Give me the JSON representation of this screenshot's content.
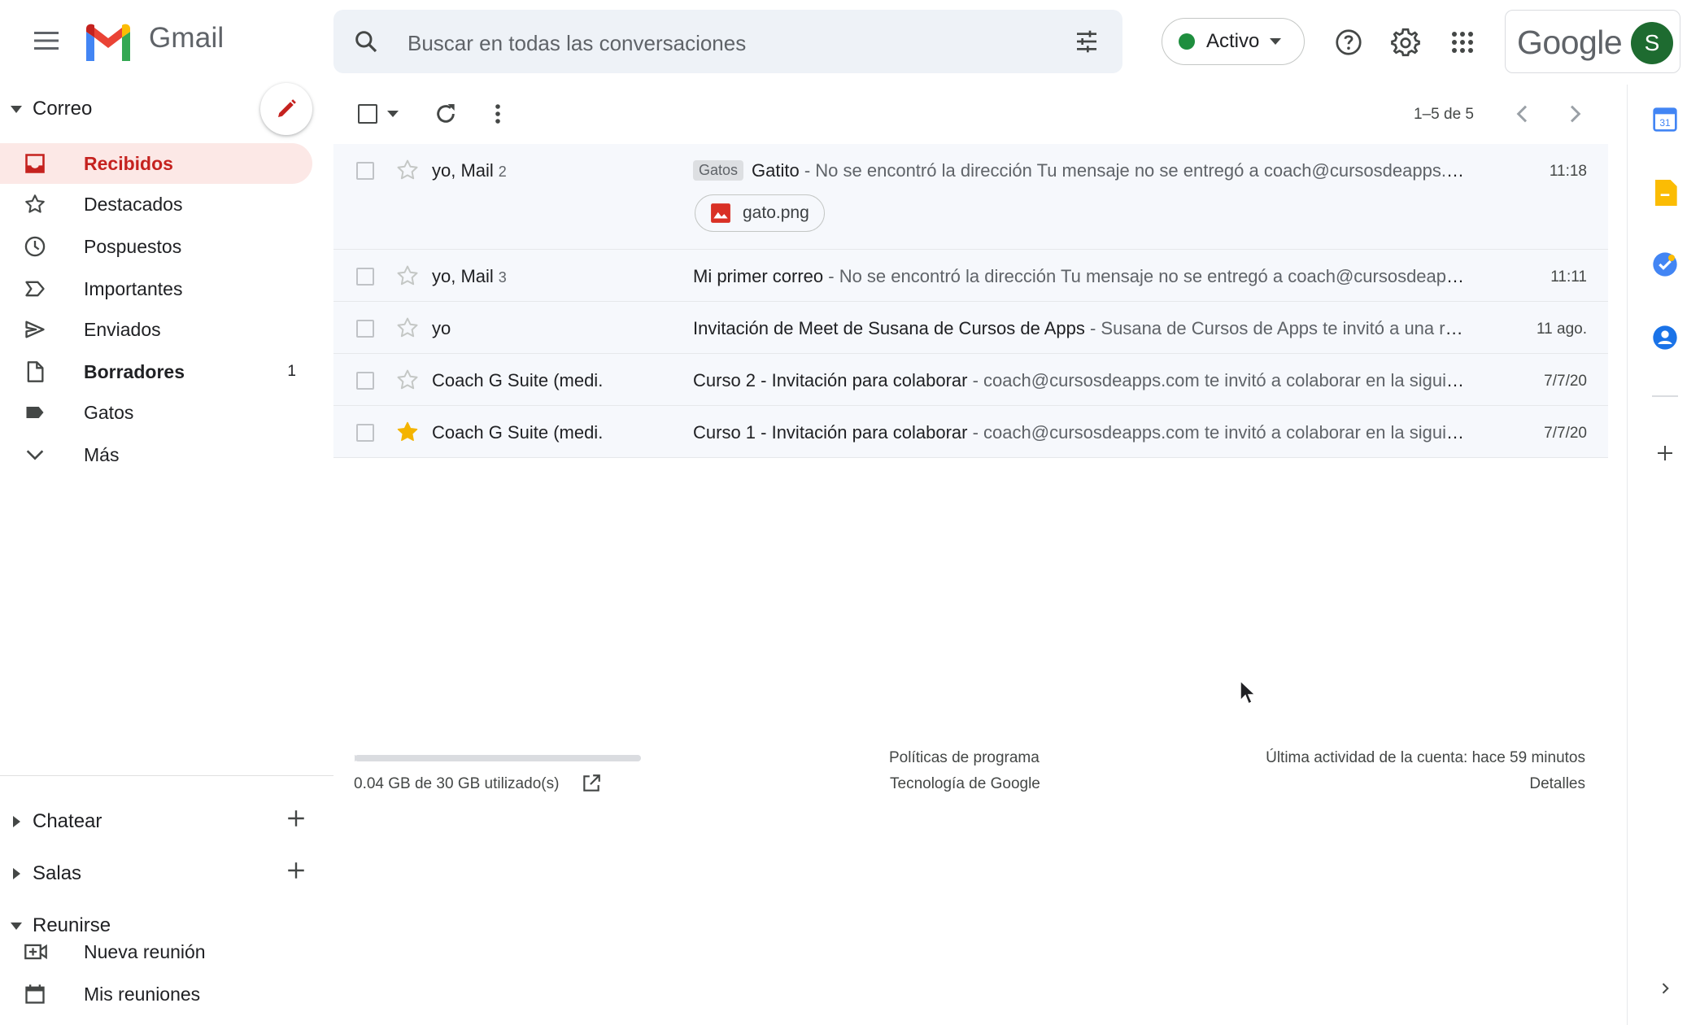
{
  "app": {
    "name": "Gmail"
  },
  "search": {
    "placeholder": "Buscar en todas las conversaciones"
  },
  "status": {
    "label": "Activo",
    "color": "#1e8e3e"
  },
  "account": {
    "brand": "Google",
    "avatar_letter": "S"
  },
  "sidebar": {
    "mail_section": "Correo",
    "items": [
      {
        "label": "Recibidos",
        "icon": "inbox-icon",
        "active": true,
        "count": ""
      },
      {
        "label": "Destacados",
        "icon": "star-icon",
        "count": ""
      },
      {
        "label": "Pospuestos",
        "icon": "clock-icon",
        "count": ""
      },
      {
        "label": "Importantes",
        "icon": "label-important-icon",
        "count": ""
      },
      {
        "label": "Enviados",
        "icon": "send-icon",
        "count": ""
      },
      {
        "label": "Borradores",
        "icon": "draft-icon",
        "count": "1",
        "bold": true
      },
      {
        "label": "Gatos",
        "icon": "label-icon",
        "count": ""
      },
      {
        "label": "Más",
        "icon": "chevron-down-icon",
        "count": ""
      }
    ],
    "chat_section": "Chatear",
    "rooms_section": "Salas",
    "meet_section": "Reunirse",
    "meet_items": [
      {
        "label": "Nueva reunión",
        "icon": "video-add-icon"
      },
      {
        "label": "Mis reuniones",
        "icon": "calendar-icon"
      }
    ]
  },
  "toolbar": {
    "pager": "1–5 de 5"
  },
  "emails": [
    {
      "sender": "yo, Mail",
      "count": "2",
      "tag": "Gatos",
      "subject": "Gatito",
      "snippet": " - No se encontró la dirección Tu mensaje no se entregó a coach@cursosdeapps.com porque no se encontró la dirección",
      "date": "11:18",
      "starred": false,
      "attachment": "gato.png"
    },
    {
      "sender": "yo, Mail",
      "count": "3",
      "tag": "",
      "subject": "Mi primer correo",
      "snippet": " - No se encontró la dirección Tu mensaje no se entregó a coach@cursosdeapps.com porque no se encontró",
      "date": "11:11",
      "starred": false
    },
    {
      "sender": "yo",
      "count": "",
      "tag": "",
      "subject": "Invitación de Meet de Susana de Cursos de Apps",
      "snippet": " - Susana de Cursos de Apps te invitó a una reunión",
      "date": "11 ago.",
      "starred": false
    },
    {
      "sender": "Coach G Suite (medi.",
      "count": "",
      "tag": "",
      "subject": "Curso 2 - Invitación para colaborar",
      "snippet": " - coach@cursosdeapps.com te invitó a colaborar en la siguiente",
      "date": "7/7/20",
      "starred": false
    },
    {
      "sender": "Coach G Suite (medi.",
      "count": "",
      "tag": "",
      "subject": "Curso 1 - Invitación para colaborar",
      "snippet": " - coach@cursosdeapps.com te invitó a colaborar en la siguiente",
      "date": "7/7/20",
      "starred": true
    }
  ],
  "footer": {
    "storage": "0.04 GB de 30 GB utilizado(s)",
    "storage_fraction": 0.0013,
    "policies": "Políticas de programa",
    "tech": "Tecnología de Google",
    "last_activity": "Última actividad de la cuenta: hace 59 minutos",
    "details": "Detalles"
  }
}
